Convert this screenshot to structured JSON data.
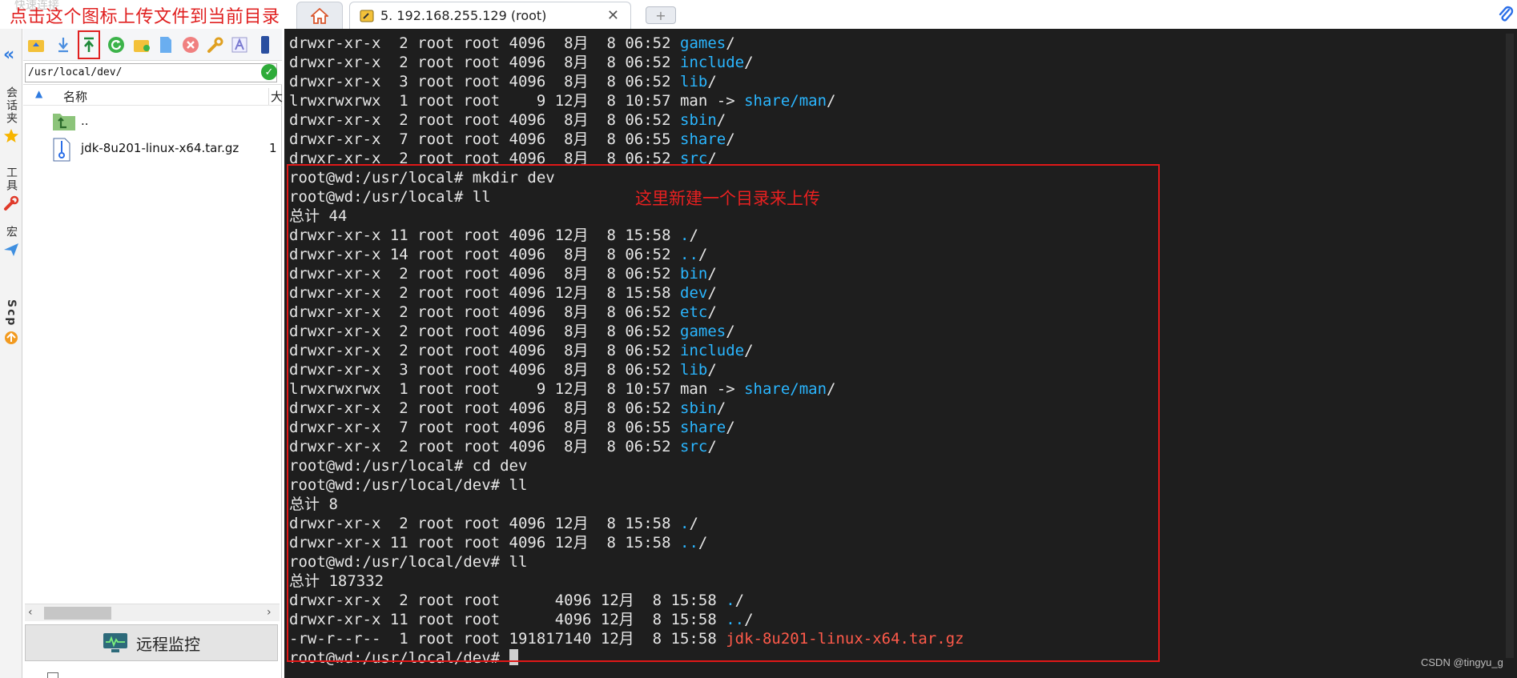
{
  "header": {
    "quick_connect": "快速连接",
    "annotation_upload": "点击这个图标上传文件到当前目录",
    "home_tab_icon": "home-icon",
    "session_tab": "5. 192.168.255.129 (root)",
    "close_glyph": "✕",
    "new_tab_glyph": "+"
  },
  "left_tabs": [
    {
      "label": "会话夹",
      "icon": "star-icon"
    },
    {
      "label": "工具",
      "icon": "tools-icon"
    },
    {
      "label": "宏",
      "icon": "paper-plane-icon"
    },
    {
      "label": "Scp",
      "icon": "scp-icon"
    }
  ],
  "file_panel": {
    "path": "/usr/local/dev/",
    "col_name": "名称",
    "col_size": "大",
    "files": [
      {
        "name": "..",
        "size": "",
        "icon": "folder-up-icon"
      },
      {
        "name": "jdk-8u201-linux-x64.tar.gz",
        "size": "1",
        "icon": "archive-file-icon"
      }
    ],
    "monitor_label": "远程监控"
  },
  "terminal": {
    "annotation": "这里新建一个目录来上传",
    "lines": [
      {
        "segs": [
          {
            "t": "drwxr-xr-x  2 root root 4096  8月  8 06:52 "
          },
          {
            "t": "games",
            "c": "dir"
          },
          {
            "t": "/"
          }
        ]
      },
      {
        "segs": [
          {
            "t": "drwxr-xr-x  2 root root 4096  8月  8 06:52 "
          },
          {
            "t": "include",
            "c": "dir"
          },
          {
            "t": "/"
          }
        ]
      },
      {
        "segs": [
          {
            "t": "drwxr-xr-x  3 root root 4096  8月  8 06:52 "
          },
          {
            "t": "lib",
            "c": "dir"
          },
          {
            "t": "/"
          }
        ]
      },
      {
        "segs": [
          {
            "t": "lrwxrwxrwx  1 root root    9 12月  8 10:57 man -> "
          },
          {
            "t": "share/man",
            "c": "dir"
          },
          {
            "t": "/"
          }
        ]
      },
      {
        "segs": [
          {
            "t": "drwxr-xr-x  2 root root 4096  8月  8 06:52 "
          },
          {
            "t": "sbin",
            "c": "dir"
          },
          {
            "t": "/"
          }
        ]
      },
      {
        "segs": [
          {
            "t": "drwxr-xr-x  7 root root 4096  8月  8 06:55 "
          },
          {
            "t": "share",
            "c": "dir"
          },
          {
            "t": "/"
          }
        ]
      },
      {
        "segs": [
          {
            "t": "drwxr-xr-x  2 root root 4096  8月  8 06:52 "
          },
          {
            "t": "src",
            "c": "dir"
          },
          {
            "t": "/"
          }
        ]
      },
      {
        "segs": [
          {
            "t": "root@wd:/usr/local# mkdir dev"
          }
        ]
      },
      {
        "segs": [
          {
            "t": "root@wd:/usr/local# ll"
          }
        ]
      },
      {
        "segs": [
          {
            "t": "总计 44"
          }
        ]
      },
      {
        "segs": [
          {
            "t": "drwxr-xr-x 11 root root 4096 12月  8 15:58 "
          },
          {
            "t": ".",
            "c": "dir"
          },
          {
            "t": "/"
          }
        ]
      },
      {
        "segs": [
          {
            "t": "drwxr-xr-x 14 root root 4096  8月  8 06:52 "
          },
          {
            "t": "..",
            "c": "dir"
          },
          {
            "t": "/"
          }
        ]
      },
      {
        "segs": [
          {
            "t": "drwxr-xr-x  2 root root 4096  8月  8 06:52 "
          },
          {
            "t": "bin",
            "c": "dir"
          },
          {
            "t": "/"
          }
        ]
      },
      {
        "segs": [
          {
            "t": "drwxr-xr-x  2 root root 4096 12月  8 15:58 "
          },
          {
            "t": "dev",
            "c": "dir"
          },
          {
            "t": "/"
          }
        ]
      },
      {
        "segs": [
          {
            "t": "drwxr-xr-x  2 root root 4096  8月  8 06:52 "
          },
          {
            "t": "etc",
            "c": "dir"
          },
          {
            "t": "/"
          }
        ]
      },
      {
        "segs": [
          {
            "t": "drwxr-xr-x  2 root root 4096  8月  8 06:52 "
          },
          {
            "t": "games",
            "c": "dir"
          },
          {
            "t": "/"
          }
        ]
      },
      {
        "segs": [
          {
            "t": "drwxr-xr-x  2 root root 4096  8月  8 06:52 "
          },
          {
            "t": "include",
            "c": "dir"
          },
          {
            "t": "/"
          }
        ]
      },
      {
        "segs": [
          {
            "t": "drwxr-xr-x  3 root root 4096  8月  8 06:52 "
          },
          {
            "t": "lib",
            "c": "dir"
          },
          {
            "t": "/"
          }
        ]
      },
      {
        "segs": [
          {
            "t": "lrwxrwxrwx  1 root root    9 12月  8 10:57 man -> "
          },
          {
            "t": "share/man",
            "c": "dir"
          },
          {
            "t": "/"
          }
        ]
      },
      {
        "segs": [
          {
            "t": "drwxr-xr-x  2 root root 4096  8月  8 06:52 "
          },
          {
            "t": "sbin",
            "c": "dir"
          },
          {
            "t": "/"
          }
        ]
      },
      {
        "segs": [
          {
            "t": "drwxr-xr-x  7 root root 4096  8月  8 06:55 "
          },
          {
            "t": "share",
            "c": "dir"
          },
          {
            "t": "/"
          }
        ]
      },
      {
        "segs": [
          {
            "t": "drwxr-xr-x  2 root root 4096  8月  8 06:52 "
          },
          {
            "t": "src",
            "c": "dir"
          },
          {
            "t": "/"
          }
        ]
      },
      {
        "segs": [
          {
            "t": "root@wd:/usr/local# cd dev"
          }
        ]
      },
      {
        "segs": [
          {
            "t": "root@wd:/usr/local/dev# ll"
          }
        ]
      },
      {
        "segs": [
          {
            "t": "总计 8"
          }
        ]
      },
      {
        "segs": [
          {
            "t": "drwxr-xr-x  2 root root 4096 12月  8 15:58 "
          },
          {
            "t": ".",
            "c": "dir"
          },
          {
            "t": "/"
          }
        ]
      },
      {
        "segs": [
          {
            "t": "drwxr-xr-x 11 root root 4096 12月  8 15:58 "
          },
          {
            "t": "..",
            "c": "dir"
          },
          {
            "t": "/"
          }
        ]
      },
      {
        "segs": [
          {
            "t": "root@wd:/usr/local/dev# ll"
          }
        ]
      },
      {
        "segs": [
          {
            "t": "总计 187332"
          }
        ]
      },
      {
        "segs": [
          {
            "t": "drwxr-xr-x  2 root root      4096 12月  8 15:58 "
          },
          {
            "t": ".",
            "c": "dir"
          },
          {
            "t": "/"
          }
        ]
      },
      {
        "segs": [
          {
            "t": "drwxr-xr-x 11 root root      4096 12月  8 15:58 "
          },
          {
            "t": "..",
            "c": "dir"
          },
          {
            "t": "/"
          }
        ]
      },
      {
        "segs": [
          {
            "t": "-rw-r--r--  1 root root 191817140 12月  8 15:58 "
          },
          {
            "t": "jdk-8u201-linux-x64.tar.gz",
            "c": "arch"
          }
        ]
      },
      {
        "segs": [
          {
            "t": "root@wd:/usr/local/dev# "
          }
        ],
        "cursor": true
      }
    ]
  },
  "watermark": "CSDN @tingyu_g",
  "colors": {
    "terminal_bg": "#1e1e1e",
    "dir_blue": "#2ab6ff",
    "archive_red": "#ff5a4a",
    "annotation_red": "#e02020"
  }
}
